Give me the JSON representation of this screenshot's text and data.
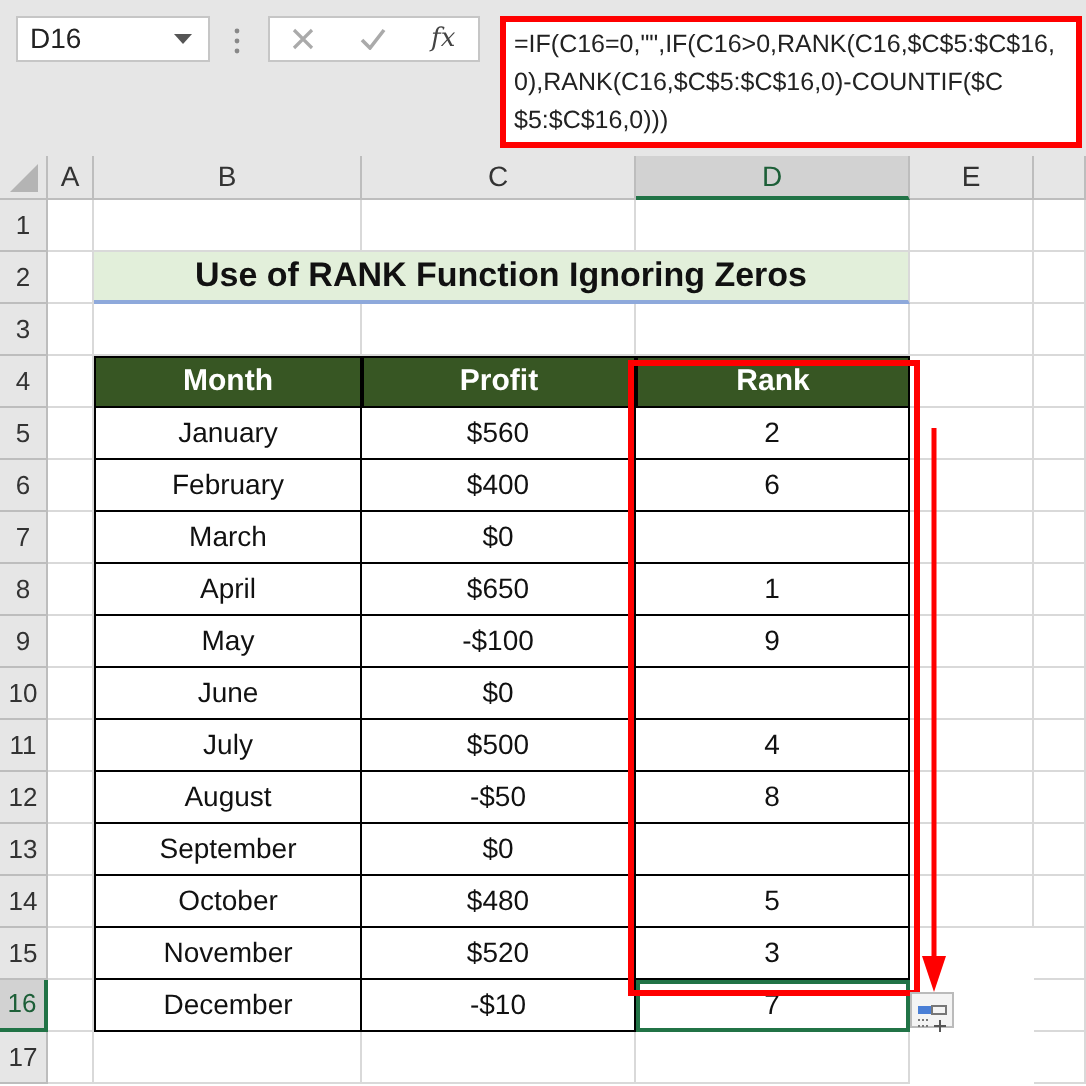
{
  "name_box": "D16",
  "function_button": "fx",
  "formula": "=IF(C16=0,\"\",IF(C16>0,RANK(C16,$C$5:$C$16,0),RANK(C16,$C$5:$C$16,0)-COUNTIF($C$5:$C$16,0)))",
  "column_headers": [
    {
      "label": "A",
      "selected": false
    },
    {
      "label": "B",
      "selected": false
    },
    {
      "label": "C",
      "selected": false
    },
    {
      "label": "D",
      "selected": true
    },
    {
      "label": "E",
      "selected": false
    }
  ],
  "row_headers": [
    {
      "label": "1",
      "selected": false
    },
    {
      "label": "2",
      "selected": false
    },
    {
      "label": "3",
      "selected": false
    },
    {
      "label": "4",
      "selected": false
    },
    {
      "label": "5",
      "selected": false
    },
    {
      "label": "6",
      "selected": false
    },
    {
      "label": "7",
      "selected": false
    },
    {
      "label": "8",
      "selected": false
    },
    {
      "label": "9",
      "selected": false
    },
    {
      "label": "10",
      "selected": false
    },
    {
      "label": "11",
      "selected": false
    },
    {
      "label": "12",
      "selected": false
    },
    {
      "label": "13",
      "selected": false
    },
    {
      "label": "14",
      "selected": false
    },
    {
      "label": "15",
      "selected": false
    },
    {
      "label": "16",
      "selected": true
    },
    {
      "label": "17",
      "selected": false
    }
  ],
  "title": "Use of RANK Function Ignoring Zeros",
  "table": {
    "columns": [
      "Month",
      "Profit",
      "Rank"
    ],
    "rows": [
      {
        "month": "January",
        "profit": "$560",
        "rank": "2"
      },
      {
        "month": "February",
        "profit": "$400",
        "rank": "6"
      },
      {
        "month": "March",
        "profit": "$0"
      },
      {
        "month": "April",
        "profit": "$650",
        "rank": "1"
      },
      {
        "month": "May",
        "profit": "-$100",
        "rank": "9"
      },
      {
        "month": "June",
        "profit": "$0"
      },
      {
        "month": "July",
        "profit": "$500",
        "rank": "4"
      },
      {
        "month": "August",
        "profit": "-$50",
        "rank": "8"
      },
      {
        "month": "September",
        "profit": "$0"
      },
      {
        "month": "October",
        "profit": "$480",
        "rank": "5"
      },
      {
        "month": "November",
        "profit": "$520",
        "rank": "3"
      },
      {
        "month": "December",
        "profit": "-$10",
        "rank": "7"
      }
    ]
  }
}
